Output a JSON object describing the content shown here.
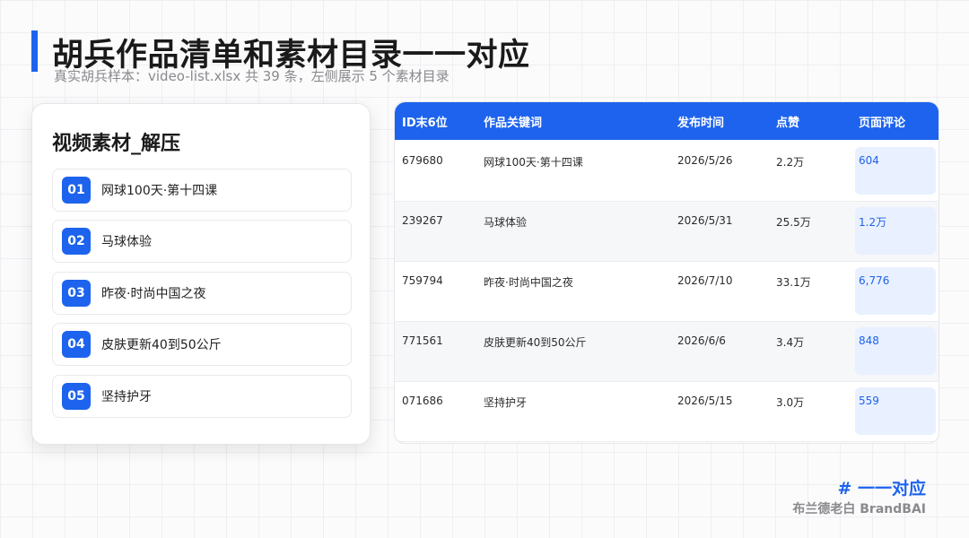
{
  "header": {
    "title": "胡兵作品清单和素材目录一一对应",
    "subtitle": "真实胡兵样本：video-list.xlsx 共 39 条，左侧展示 5 个素材目录"
  },
  "left_card": {
    "title": "视频素材_解压",
    "items": [
      {
        "num": "01",
        "label": "网球100天·第十四课"
      },
      {
        "num": "02",
        "label": "马球体验"
      },
      {
        "num": "03",
        "label": "昨夜·时尚中国之夜"
      },
      {
        "num": "04",
        "label": "皮肤更新40到50公斤"
      },
      {
        "num": "05",
        "label": "坚持护牙"
      }
    ]
  },
  "table": {
    "headers": [
      "ID末6位",
      "作品关键词",
      "发布时间",
      "点赞",
      "页面评论"
    ],
    "rows": [
      [
        "679680",
        "网球100天·第十四课",
        "2026/5/26",
        "2.2万",
        "604"
      ],
      [
        "239267",
        "马球体验",
        "2026/5/31",
        "25.5万",
        "1.2万"
      ],
      [
        "759794",
        "昨夜·时尚中国之夜",
        "2026/7/10",
        "33.1万",
        "6,776"
      ],
      [
        "771561",
        "皮肤更新40到50公斤",
        "2026/6/6",
        "3.4万",
        "848"
      ],
      [
        "071686",
        "坚持护牙",
        "2026/5/15",
        "3.0万",
        "559"
      ]
    ]
  },
  "footer": {
    "tag": "# 一一对应",
    "brand": "布兰德老白 BrandBAI"
  },
  "colors": {
    "accent": "#1d63ed",
    "comment_bg": "#e9f0ff"
  }
}
